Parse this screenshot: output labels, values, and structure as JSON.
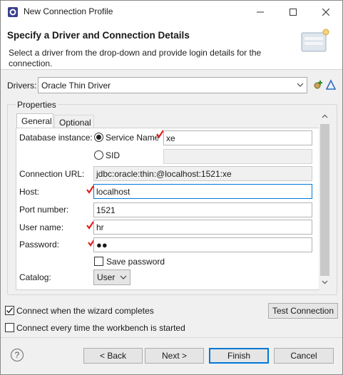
{
  "window": {
    "title": "New Connection Profile",
    "minimize_glyph": "—",
    "maximize_glyph": "☐",
    "close_glyph": "✕"
  },
  "banner": {
    "heading": "Specify a Driver and Connection Details",
    "description": "Select a driver from the drop-down and provide login details for the connection."
  },
  "drivers": {
    "label": "Drivers:",
    "selected": "Oracle Thin Driver"
  },
  "properties": {
    "group_label": "Properties",
    "tabs": [
      {
        "label": "General",
        "active": true
      },
      {
        "label": "Optional",
        "active": false
      }
    ],
    "database_instance": {
      "label": "Database instance:",
      "service_name_label": "Service Name",
      "service_name_value": "xe",
      "sid_label": "SID",
      "sid_value": "",
      "selected": "service_name"
    },
    "connection_url": {
      "label": "Connection URL:",
      "value": "jdbc:oracle:thin:@localhost:1521:xe"
    },
    "host": {
      "label": "Host:",
      "value": "localhost"
    },
    "port": {
      "label": "Port number:",
      "value": "1521"
    },
    "user": {
      "label": "User name:",
      "value": "hr"
    },
    "password": {
      "label": "Password:",
      "value": "●●"
    },
    "save_password": {
      "label": "Save password",
      "checked": false
    },
    "catalog": {
      "label": "Catalog:",
      "selected": "User"
    }
  },
  "options": {
    "connect_when_complete": {
      "label": "Connect when the wizard completes",
      "checked": true
    },
    "connect_every_time": {
      "label": "Connect every time the workbench is started",
      "checked": false
    },
    "test_connection": "Test Connection"
  },
  "buttons": {
    "help": "?",
    "back": "< Back",
    "next": "Next >",
    "finish": "Finish",
    "cancel": "Cancel"
  },
  "colors": {
    "annotation_red": "#e0201b",
    "focus_blue": "#0078d7"
  }
}
